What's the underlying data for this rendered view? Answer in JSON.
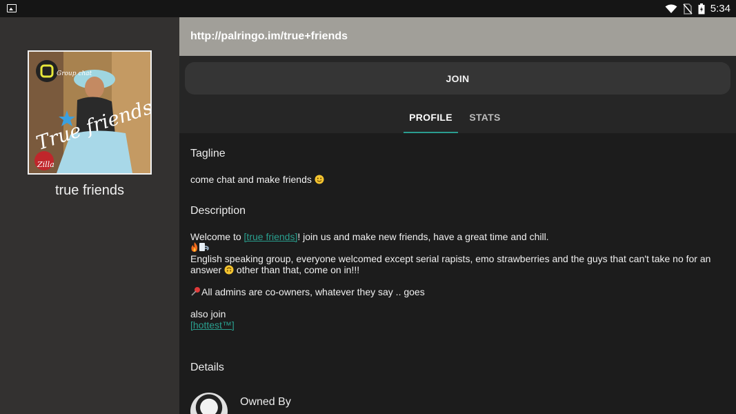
{
  "status_bar": {
    "time": "5:34"
  },
  "group": {
    "name": "true friends",
    "image_text": [
      "Group chat",
      "True friends",
      "Zilla"
    ]
  },
  "url": "http://palringo.im/true+friends",
  "join_label": "JOIN",
  "tabs": [
    {
      "label": "PROFILE",
      "active": true
    },
    {
      "label": "STATS",
      "active": false
    }
  ],
  "accent_color": "#2a9d8f",
  "tagline": {
    "heading": "Tagline",
    "text": "come chat and make friends"
  },
  "description": {
    "heading": "Description",
    "line1_prefix": "Welcome to ",
    "line1_link": "[true friends]",
    "line1_suffix": "! join us and make new friends, have a great time and chill.",
    "line3": "English speaking group, everyone welcomed except serial rapists, emo strawberries and the guys that can't take no for an",
    "line4_prefix": "answer ",
    "line4_suffix": " other than that, come on in!!!",
    "line5": "All admins are co-owners, whatever they say .. goes",
    "line6": "also join",
    "line7_link": "[hottest™]"
  },
  "details": {
    "heading": "Details",
    "owned_by_label": "Owned By"
  }
}
